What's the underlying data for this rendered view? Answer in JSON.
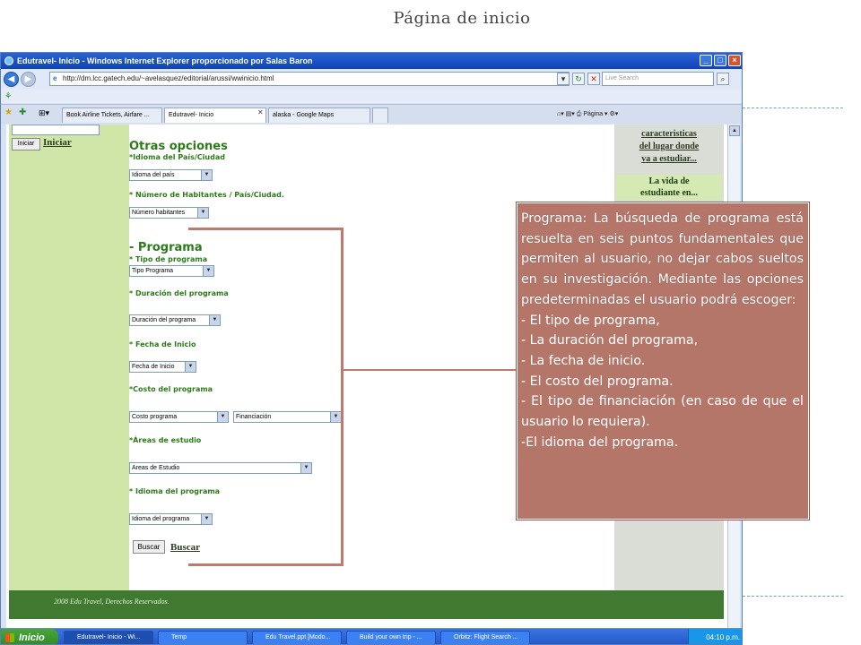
{
  "slide": {
    "title": "Página de inicio"
  },
  "browser": {
    "title": "Edutravel- Inicio - Windows Internet Explorer proporcionado por Salas Baron",
    "url": "http://dm.lcc.gatech.edu/~avelasquez/editorial/arussi/wwinicio.html",
    "search_placeholder": "Live Search",
    "tabs": [
      {
        "label": "Book Airline Tickets, Airfare ..."
      },
      {
        "label": "Edutravel- Inicio"
      },
      {
        "label": "alaska - Google Maps"
      }
    ],
    "toolbar_right": "Página ▾  ⚙▾"
  },
  "page": {
    "iniciar_button": "Iniciar",
    "iniciar_link": "Iniciar",
    "otras_opciones": "Otras opciones",
    "idioma_pais_label": "*Idioma del País/Ciudad",
    "idioma_pais_select": "Idioma del país",
    "habitantes_label": "* Número de Habitantes / País/Ciudad.",
    "habitantes_select": "Número habitantes",
    "programa_heading": "- Programa",
    "tipo_label": "* Tipo de programa",
    "tipo_select": "Tipo Programa",
    "duracion_label": "* Duración del programa",
    "duracion_select": "Duración del programa",
    "fecha_label": "* Fecha de Inicio",
    "fecha_select": "Fecha de Inicio",
    "costo_label": "*Costo del programa",
    "costo_select": "Costo programa",
    "financiacion_select": "Financiación",
    "areas_label": "*Áreas de estudio",
    "areas_select": "Areas de Estudio",
    "idioma_programa_label": "* Idioma del programa",
    "idioma_programa_select": "Idioma del programa",
    "buscar_button": "Buscar",
    "buscar_link": "Buscar",
    "right_link_1": "caracteristicas",
    "right_link_2": "del lugar donde",
    "right_link_3": "va a estudiar...",
    "right_vida_1": "La vida de",
    "right_vida_2": "estudiante en...",
    "footer": "2008 Edu Travel, Derechos Reservados."
  },
  "taskbar": {
    "start": "Inicio",
    "items": [
      "Edutravel- Inicio - Wi...",
      "Temp",
      "Edu Travel.ppt [Modo...",
      "Build your own trip - ...",
      "Orbitz: Flight Search ..."
    ],
    "clock": "04:10 p.m."
  },
  "annotation": {
    "paragraph": "Programa: La búsqueda de programa está resuelta en seis puntos fundamentales que permiten al usuario, no dejar cabos sueltos en su investigación. Mediante las opciones predeterminadas el usuario podrá escoger:",
    "items": [
      "- El tipo de programa,",
      "- La duración del programa,",
      "- La fecha de inicio.",
      "- El costo del programa.",
      "- El tipo de financiación (en caso de que el usuario lo requiera).",
      "-El idioma del programa."
    ]
  }
}
